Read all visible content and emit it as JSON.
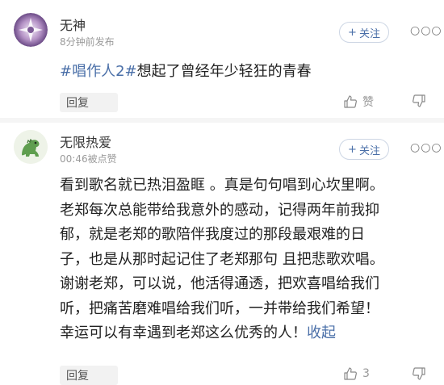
{
  "posts": [
    {
      "username": "无神",
      "meta": "8分钟前发布",
      "follow_label": "关注",
      "hashtag": "#唱作人2#",
      "text": "想起了曾经年少轻狂的青春",
      "reply_label": "回复",
      "like_label": "赞"
    },
    {
      "username": "无限热爱",
      "meta": "00:46被点赞",
      "follow_label": "关注",
      "lines": [
        "看到歌名就已热泪盈眶 。真是句句唱到心坎里啊。",
        "老郑每次总能带给我意外的感动，记得两年前我抑",
        "郁，就是老郑的歌陪伴我度过的那段最艰难的日",
        "子，也是从那时起记住了老郑那句 且把悲歌欢唱。",
        "谢谢老郑，可以说，他活得通透，把欢喜唱给我们",
        "听，把痛苦磨难唱给我们听，一并带给我们希望！",
        "幸运可以有幸遇到老郑这么优秀的人！"
      ],
      "collapse_label": "收起",
      "reply_label": "回复",
      "like_label": "3"
    }
  ],
  "icons": {
    "plus": "+",
    "more": "○○○"
  },
  "colors": {
    "link": "#4a6fa8",
    "meta": "#9a9a9a",
    "reply_bg": "#f2f2f2"
  }
}
